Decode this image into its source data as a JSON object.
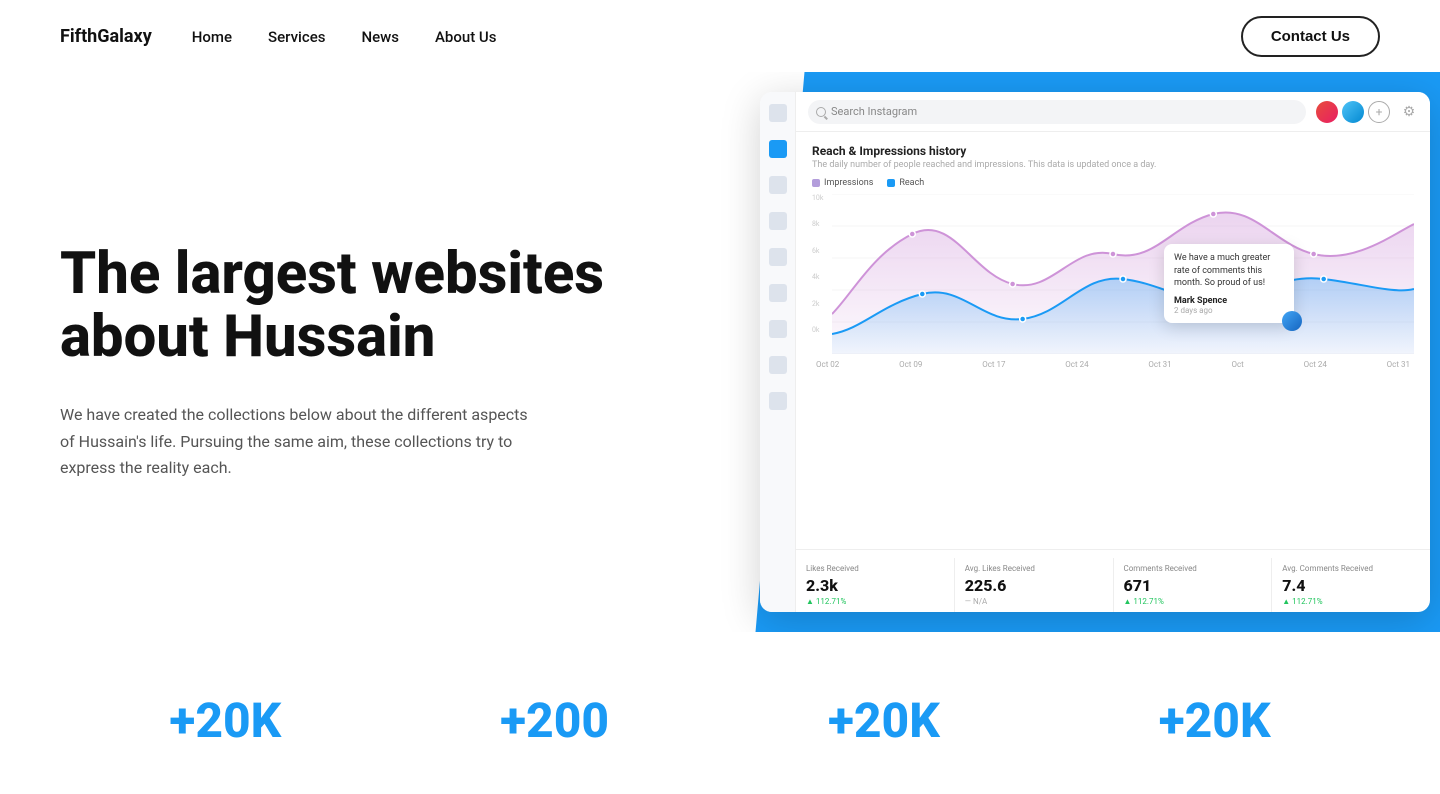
{
  "navbar": {
    "brand": "FifthGalaxy",
    "links": [
      {
        "label": "Home",
        "id": "home"
      },
      {
        "label": "Services",
        "id": "services"
      },
      {
        "label": "News",
        "id": "news"
      },
      {
        "label": "About Us",
        "id": "about"
      },
      {
        "label": "Contact Us",
        "id": "contact"
      }
    ],
    "contact_btn": "Contact Us"
  },
  "hero": {
    "title": "The largest websites about Hussain",
    "description": "We have created the collections below about the different aspects of Hussain's life. Pursuing the same aim, these collections try to express the reality each."
  },
  "dashboard": {
    "search_placeholder": "Search Instagram",
    "chart_title": "Reach & Impressions history",
    "chart_subtitle": "The daily number of people reached and impressions. This data is updated once a day.",
    "legend_impressions": "Impressions",
    "legend_reach": "Reach",
    "x_labels": [
      "Oct 02",
      "Oct 09",
      "Oct 17",
      "Oct 24",
      "Oct 31",
      "Oct",
      "Oct 24",
      "Oct 31"
    ],
    "y_labels": [
      "0k",
      "2k",
      "4k",
      "6k",
      "8k",
      "10k"
    ],
    "tooltip": {
      "text": "We have a much greater rate of comments this month. So proud of us!",
      "user": "Mark Spence",
      "time": "2 days ago"
    },
    "stats": [
      {
        "label": "Likes Received",
        "value": "2.3k",
        "change": "▲ 112.71%",
        "positive": true
      },
      {
        "label": "Avg. Likes Received",
        "value": "225.6",
        "change": "— N/A",
        "positive": false
      },
      {
        "label": "Comments Received",
        "value": "671",
        "change": "▲ 112.71%",
        "positive": true
      },
      {
        "label": "Avg. Comments Received",
        "value": "7.4",
        "change": "▲ 112.71%",
        "positive": true
      }
    ]
  },
  "bottom_stats": [
    {
      "value": "+20K",
      "id": "stat1"
    },
    {
      "value": "+200",
      "id": "stat2"
    },
    {
      "value": "+20K",
      "id": "stat3"
    },
    {
      "value": "+20K",
      "id": "stat4"
    }
  ],
  "colors": {
    "blue": "#1a9af5",
    "dark": "#111111",
    "gray": "#555555"
  }
}
